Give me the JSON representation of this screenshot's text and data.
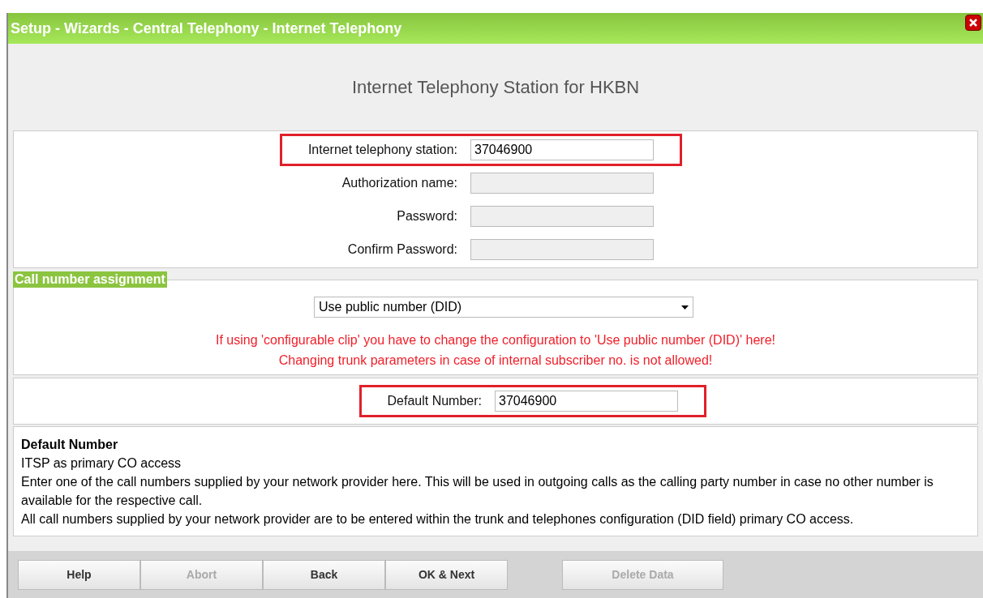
{
  "window": {
    "title": "Setup - Wizards - Central Telephony - Internet Telephony"
  },
  "heading": "Internet Telephony Station for HKBN",
  "fields": [
    {
      "label": "Internet telephony station:",
      "value": "37046900",
      "disabled": false,
      "highlighted": true
    },
    {
      "label": "Authorization name:",
      "disabled": true,
      "highlighted": false
    },
    {
      "label": "Password:",
      "disabled": true,
      "highlighted": false
    },
    {
      "label": "Confirm Password:",
      "disabled": true,
      "highlighted": false
    }
  ],
  "call_number_assignment": {
    "legend": "Call number assignment",
    "select_value": "Use public number (DID)",
    "warnings": [
      "If using 'configurable clip' you have to change the configuration to 'Use public number (DID)' here!",
      "Changing trunk parameters in case of internal subscriber no. is not allowed!"
    ]
  },
  "default_number": {
    "label": "Default Number:",
    "value": "37046900",
    "disabled": false,
    "highlighted": true
  },
  "help": {
    "title": "Default Number",
    "lines": [
      "ITSP as primary CO access",
      "Enter one of the call numbers supplied by your network provider here. This will be used in outgoing calls as the calling party number in case no other number is available for the respective call.",
      "All call numbers supplied by your network provider are to be entered within the trunk and telephones configuration (DID field) primary CO access."
    ]
  },
  "buttons": [
    {
      "label": "Help",
      "disabled": false
    },
    {
      "label": "Abort",
      "disabled": true
    },
    {
      "label": "Back",
      "disabled": false
    },
    {
      "label": "OK & Next",
      "disabled": false
    },
    {
      "label": "Delete Data",
      "disabled": true,
      "separate": true
    }
  ]
}
